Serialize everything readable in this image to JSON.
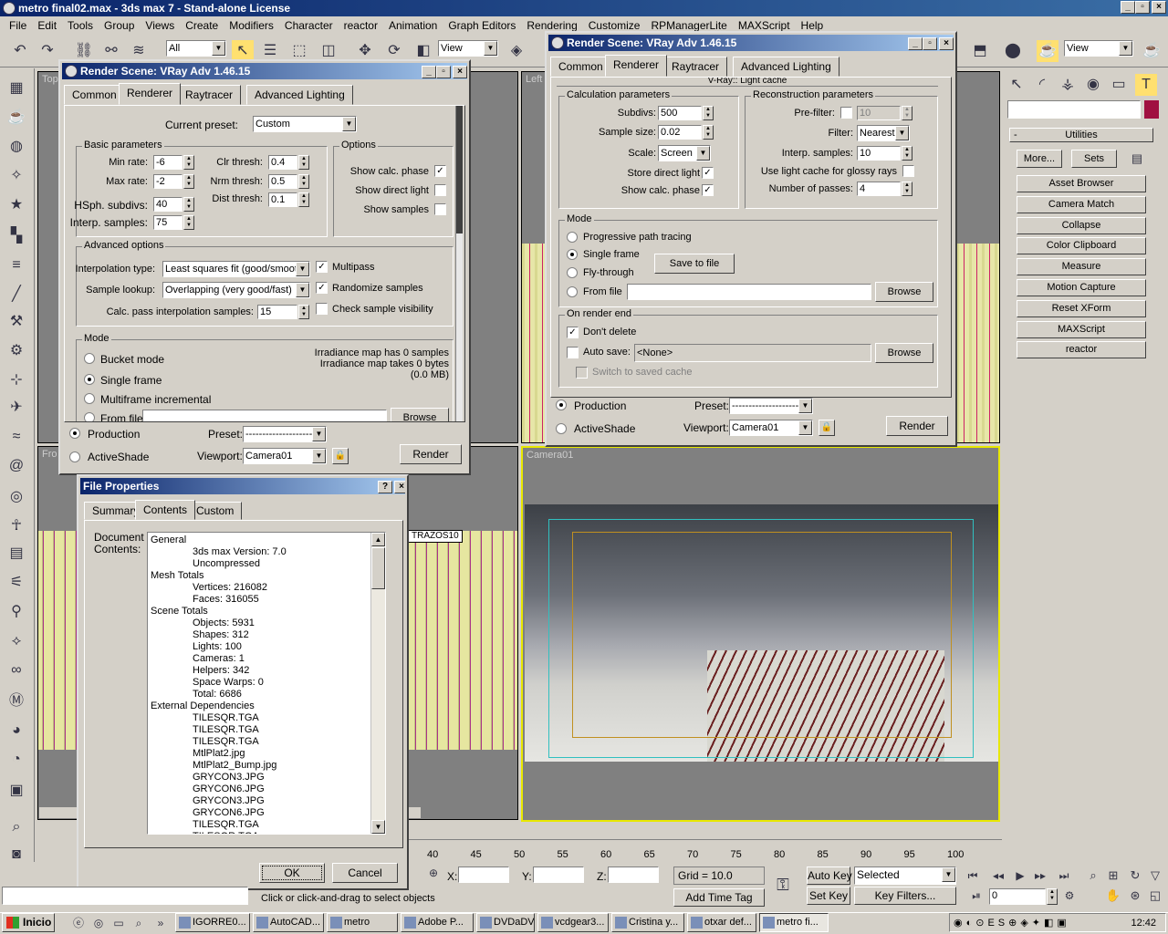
{
  "app": {
    "title": "metro final02.max - 3ds max 7 - Stand-alone License",
    "menu": [
      "File",
      "Edit",
      "Tools",
      "Group",
      "Views",
      "Create",
      "Modifiers",
      "Character",
      "reactor",
      "Animation",
      "Graph Editors",
      "Rendering",
      "Customize",
      "RPManagerLite",
      "MAXScript",
      "Help"
    ],
    "selection_filter": "All",
    "view_label": "View",
    "view_label2": "View"
  },
  "viewports": {
    "top": "Top",
    "left": "Left",
    "front": "Front",
    "camera": "Camera01",
    "trazos": "TRAZOS10"
  },
  "render1": {
    "title": "Render Scene: VRay Adv 1.46.15",
    "tabs": [
      "Common",
      "Renderer",
      "Raytracer",
      "Advanced Lighting"
    ],
    "current_preset_label": "Current preset:",
    "current_preset": "Custom",
    "basic_title": "Basic parameters",
    "min_rate_label": "Min rate:",
    "min_rate": "-6",
    "max_rate_label": "Max rate:",
    "max_rate": "-2",
    "hsph_label": "HSph. subdivs:",
    "hsph": "40",
    "interp_label": "Interp. samples:",
    "interp": "75",
    "clr_label": "Clr thresh:",
    "clr": "0.4",
    "nrm_label": "Nrm thresh:",
    "nrm": "0.5",
    "dist_label": "Dist thresh:",
    "dist": "0.1",
    "options_title": "Options",
    "opt1": "Show calc. phase",
    "opt2": "Show direct light",
    "opt3": "Show samples",
    "adv_title": "Advanced options",
    "interp_type_label": "Interpolation type:",
    "interp_type": "Least squares fit (good/smoot",
    "lookup_label": "Sample lookup:",
    "lookup": "Overlapping (very good/fast)",
    "calc_pass_label": "Calc. pass interpolation samples:",
    "calc_pass": "15",
    "multipass": "Multipass",
    "randomize": "Randomize samples",
    "check_vis": "Check sample visibility",
    "mode_title": "Mode",
    "bucket": "Bucket mode",
    "single": "Single frame",
    "multiframe": "Multiframe incremental",
    "from_file": "From file:",
    "browse": "Browse",
    "irr1": "Irradiance map has 0 samples",
    "irr2": "Irradiance map takes 0 bytes",
    "irr3": "(0.0 MB)",
    "production": "Production",
    "activeshade": "ActiveShade",
    "preset_label": "Preset:",
    "preset": "----------------------",
    "viewport_label": "Viewport:",
    "viewport": "Camera01",
    "render": "Render"
  },
  "render2": {
    "title": "Render Scene: VRay Adv 1.46.15",
    "tabs": [
      "Common",
      "Renderer",
      "Raytracer",
      "Advanced Lighting"
    ],
    "rollout": "V-Ray:: Light cache",
    "calc_title": "Calculation parameters",
    "subdivs_label": "Subdivs:",
    "subdivs": "500",
    "sample_size_label": "Sample size:",
    "sample_size": "0.02",
    "scale_label": "Scale:",
    "scale": "Screen",
    "store_direct": "Store direct light",
    "show_calc": "Show calc. phase",
    "recon_title": "Reconstruction parameters",
    "prefilter_label": "Pre-filter:",
    "prefilter": "10",
    "filter_label": "Filter:",
    "filter": "Nearest",
    "interp_label": "Interp. samples:",
    "interp": "10",
    "glossy": "Use light cache for glossy rays",
    "passes_label": "Number of passes:",
    "passes": "4",
    "mode_title": "Mode",
    "progressive": "Progressive path tracing",
    "single": "Single frame",
    "fly": "Fly-through",
    "from_file": "From file",
    "save_to_file": "Save to file",
    "browse": "Browse",
    "end_title": "On render end",
    "dont_delete": "Don't delete",
    "auto_save": "Auto save:",
    "auto_save_val": "<None>",
    "switch": "Switch to saved cache",
    "production": "Production",
    "activeshade": "ActiveShade",
    "preset_label": "Preset:",
    "preset": "----------------------",
    "viewport_label": "Viewport:",
    "viewport": "Camera01",
    "render": "Render"
  },
  "fileprops": {
    "title": "File Properties",
    "tabs": [
      "Summary",
      "Contents",
      "Custom"
    ],
    "doc_label": "Document Contents:",
    "lines": [
      "General",
      "3ds max Version: 7.0",
      "Uncompressed",
      "Mesh Totals",
      "Vertices: 216082",
      "Faces: 316055",
      "Scene Totals",
      "Objects: 5931",
      "Shapes: 312",
      "Lights: 100",
      "Cameras: 1",
      "Helpers: 342",
      "Space Warps: 0",
      "Total: 6686",
      "External Dependencies",
      "TILESQR.TGA",
      "TILESQR.TGA",
      "TILESQR.TGA",
      "MtlPlat2.jpg",
      "MtlPlat2_Bump.jpg",
      "GRYCON3.JPG",
      "GRYCON6.JPG",
      "GRYCON3.JPG",
      "GRYCON6.JPG",
      "TILESQR.TGA",
      "TILESQR.TGA"
    ],
    "indent": [
      0,
      1,
      1,
      0,
      1,
      1,
      0,
      1,
      1,
      1,
      1,
      1,
      1,
      1,
      0,
      1,
      1,
      1,
      1,
      1,
      1,
      1,
      1,
      1,
      1,
      1
    ],
    "ok": "OK",
    "cancel": "Cancel"
  },
  "utilities": {
    "title": "Utilities",
    "more": "More...",
    "sets": "Sets",
    "items": [
      "Asset Browser",
      "Camera Match",
      "Collapse",
      "Color Clipboard",
      "Measure",
      "Motion Capture",
      "Reset XForm",
      "MAXScript",
      "reactor"
    ]
  },
  "timeline": {
    "ticks": [
      "40",
      "45",
      "50",
      "55",
      "60",
      "65",
      "70",
      "75",
      "80",
      "85",
      "90",
      "95",
      "100"
    ]
  },
  "status": {
    "prompt": "Click or click-and-drag to select objects",
    "x_label": "X:",
    "y_label": "Y:",
    "z_label": "Z:",
    "grid": "Grid = 10.0",
    "add_time_tag": "Add Time Tag",
    "auto_key": "Auto Key",
    "set_key": "Set Key",
    "selected": "Selected",
    "key_filters": "Key Filters...",
    "frame": "0"
  },
  "taskbar": {
    "start": "Inicio",
    "items": [
      "IGORRE0...",
      "AutoCAD...",
      "metro",
      "Adobe P...",
      "DVDaDV...",
      "vcdgear3...",
      "Cristina y...",
      "otxar def...",
      "metro fi..."
    ],
    "time": "12:42"
  }
}
